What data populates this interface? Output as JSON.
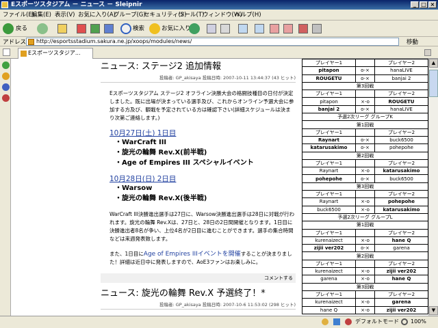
{
  "window": {
    "title": "Eスポーツスタジアム － ニュース － Sleipnir"
  },
  "menu": [
    "ファイル(E)",
    "編集(E)",
    "表示(V)",
    "お気に入り(A)",
    "グループ(G)",
    "セキュリティ(S)",
    "ツール(T)",
    "ウィンドウ(W)",
    "ヘルプ(H)"
  ],
  "toolbar": {
    "back": "戻る",
    "search": "検索",
    "favorites": "お気に入り"
  },
  "address": {
    "label": "アドレス(D)",
    "url": "http://esportsstadium.sakura.ne.jp/xoops/modules/news/",
    "go": "移動"
  },
  "tab": {
    "label": "Eスポーツスタジア..."
  },
  "post1": {
    "title": "ニュース: ステージ2 追加情報",
    "meta_poster_label": "投稿者:",
    "meta_poster": "GP_akisaya",
    "meta_date_label": "投稿日時:",
    "meta_date": "2007-10-11 13:44:37 (43 ヒット)",
    "intro": "Eスポーツスタジアム ステージ2 オフライン決勝大会の格闘技種目の日付が決定しました。既に出場が決まっている選手及び、これからオンライン予選大会に参加する方及び、観戦を予定されている方は確認下さい(詳細スケジュールは決まり次第ご連絡します。)",
    "day1_date": "10月27日(土) 1日目",
    "day1_items": [
      "WarCraft III",
      "旋光の輪舞 Rev.X(前半戦)",
      "Age of Empires III スペシャルイベント"
    ],
    "day2_date": "10月28日(日) 2日目",
    "day2_items": [
      "Warsow",
      "旋光の輪舞 Rev.X(後半戦)"
    ],
    "note1": "WarCraft III決勝進出選手は27日に、Warsow決勝進出選手は28日に対戦が行われます。旋光の輪舞 Rev.Xは、27日と、28日の2日間開催となります。1日目に決勝進出者8名が争い、上位4名が2日目に進むことができます。選手の集合時間などは来週発表致します。",
    "note2_pre": "また、1日目に",
    "note2_link": "Age of Empires IIIイベントを開催",
    "note2_post": "することが決まりました！詳細は近日中に発表しますので、AoE3ファンはお楽しみに。",
    "comment": "コメントする"
  },
  "post2": {
    "title": "ニュース: 旋光の輪舞 Rev.X 予選終了！*",
    "meta": "投稿者: GP_akisaya 投稿日時: 2007-10-6 11:53:02 (298 ヒット)"
  },
  "bracket": [
    {
      "type": "match",
      "l": "プレイヤー1",
      "m": "",
      "r": "プレイヤー2"
    },
    {
      "type": "match",
      "l": "pitapon",
      "m": "o-×",
      "r": "hanaLIVE",
      "lb": true
    },
    {
      "type": "match",
      "l": "ROUGETU",
      "m": "o-×",
      "r": "banjai 2",
      "lb": true
    },
    {
      "type": "round",
      "text": "第3回戦"
    },
    {
      "type": "match",
      "l": "プレイヤー1",
      "m": "",
      "r": "プレイヤー2"
    },
    {
      "type": "match",
      "l": "pitapon",
      "m": "×-o",
      "r": "ROUGETU",
      "rb": true
    },
    {
      "type": "match",
      "l": "banjai 2",
      "m": "o-×",
      "r": "hanaLIVE",
      "lb": true
    },
    {
      "type": "group",
      "text": "予選2次リーグ グループK"
    },
    {
      "type": "round",
      "text": "第1回戦"
    },
    {
      "type": "match",
      "l": "プレイヤー1",
      "m": "",
      "r": "プレイヤー2"
    },
    {
      "type": "match",
      "l": "Raynart",
      "m": "o-×",
      "r": "buck6500",
      "lb": true
    },
    {
      "type": "match",
      "l": "katarusakimo",
      "m": "o-×",
      "r": "pohepohe",
      "lb": true
    },
    {
      "type": "round",
      "text": "第2回戦"
    },
    {
      "type": "match",
      "l": "プレイヤー1",
      "m": "",
      "r": "プレイヤー2"
    },
    {
      "type": "match",
      "l": "Raynart",
      "m": "×-o",
      "r": "katarusakimo",
      "rb": true
    },
    {
      "type": "match",
      "l": "pohepohe",
      "m": "o-×",
      "r": "buck6500",
      "lb": true
    },
    {
      "type": "round",
      "text": "第3回戦"
    },
    {
      "type": "match",
      "l": "プレイヤー1",
      "m": "",
      "r": "プレイヤー2"
    },
    {
      "type": "match",
      "l": "Raynart",
      "m": "×-o",
      "r": "pohepohe",
      "rb": true
    },
    {
      "type": "match",
      "l": "buck6500",
      "m": "×-o",
      "r": "katarusakimo",
      "rb": true
    },
    {
      "type": "group",
      "text": "予選2次リーグ グループL"
    },
    {
      "type": "round",
      "text": "第1回戦"
    },
    {
      "type": "match",
      "l": "プレイヤー1",
      "m": "",
      "r": "プレイヤー2"
    },
    {
      "type": "match",
      "l": "kurenaizect",
      "m": "×-o",
      "r": "hane Q",
      "rb": true
    },
    {
      "type": "match",
      "l": "zijii ver202",
      "m": "o-×",
      "r": "garena",
      "lb": true
    },
    {
      "type": "round",
      "text": "第2回戦"
    },
    {
      "type": "match",
      "l": "プレイヤー1",
      "m": "",
      "r": "プレイヤー2"
    },
    {
      "type": "match",
      "l": "kurenaizect",
      "m": "×-o",
      "r": "zijii ver202",
      "rb": true
    },
    {
      "type": "match",
      "l": "garena",
      "m": "×-o",
      "r": "hane Q",
      "rb": true
    },
    {
      "type": "round",
      "text": "第3回戦"
    },
    {
      "type": "match",
      "l": "プレイヤー1",
      "m": "",
      "r": "プレイヤー2"
    },
    {
      "type": "match",
      "l": "kurenaizect",
      "m": "×-o",
      "r": "garena",
      "rb": true
    },
    {
      "type": "match",
      "l": "hane Q",
      "m": "×-o",
      "r": "zijii ver202",
      "rb": true
    }
  ],
  "status": {
    "mode": "デフォルトモード",
    "zoom": "100%"
  },
  "icons": [
    "back-icon",
    "forward-icon",
    "home-icon",
    "stop-icon",
    "refresh-icon",
    "search-icon",
    "favorites-icon",
    "print-icon",
    "mail-icon"
  ],
  "colors": {
    "title_bar": "#0a246a",
    "link": "#2040a0"
  }
}
